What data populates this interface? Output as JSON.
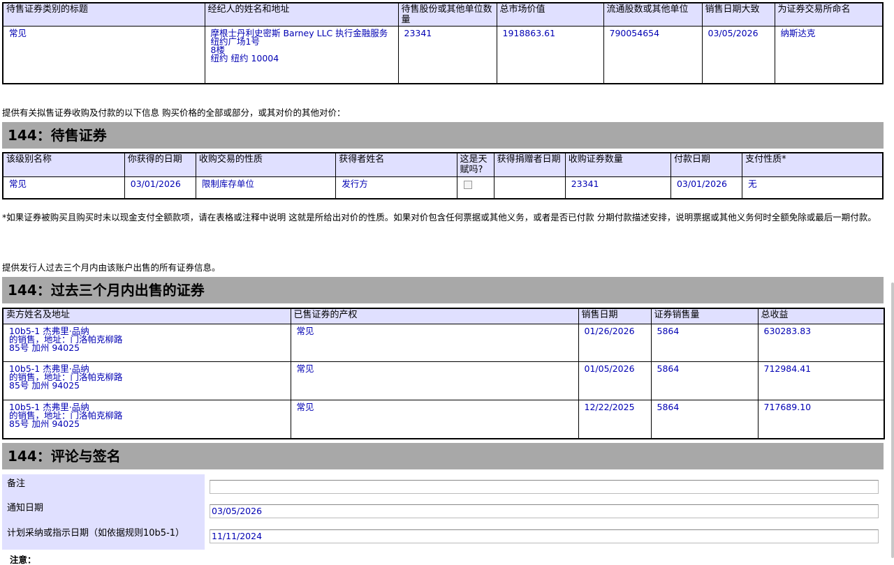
{
  "table1": {
    "headers": [
      "待售证券类别的标题",
      "经纪人的姓名和地址",
      "待售股份或其他单位数量",
      "总市场价值",
      "流通股数或其他单位",
      "销售日期大致",
      "为证券交易所命名"
    ],
    "row": {
      "title": "常见",
      "broker_lines": [
        "摩根士丹利史密斯 Barney LLC 执行金融服务",
        "纽约广场1号",
        "8楼",
        "纽约 纽约 10004"
      ],
      "units": "23341",
      "market_value": "1918863.61",
      "outstanding": "790054654",
      "sale_date": "03/05/2026",
      "exchange": "纳斯达克"
    }
  },
  "intro1": "提供有关拟售证券收购及付款的以下信息 购买价格的全部或部分，或其对价的其他对价：",
  "section1_title": "144：待售证券",
  "table2": {
    "headers": [
      "该级别名称",
      "你获得的日期",
      "收购交易的性质",
      "获得者姓名",
      "这是天赋吗?",
      "获得捐赠者日期",
      "收购证券数量",
      "付款日期",
      "支付性质*"
    ],
    "row": {
      "class": "常见",
      "acquired": "03/01/2026",
      "nature": "限制库存单位",
      "acquirer": "发行方",
      "gift": false,
      "donor_date": "",
      "amount": "23341",
      "pay_date": "03/01/2026",
      "pay_nature": "无"
    }
  },
  "footnote": "*如果证券被购买且购买时未以现金支付全额款项，请在表格或注释中说明 这就是所给出对价的性质。如果对价包含任何票据或其他义务，或者是否已付款 分期付款描述安排，说明票据或其他义务何时全额免除或最后一期付款。",
  "intro2": "提供发行人过去三个月内由该账户出售的所有证券信息。",
  "section2_title": "144：过去三个月内出售的证券",
  "table3": {
    "headers": [
      "卖方姓名及地址",
      "已售证券的产权",
      "销售日期",
      "证券销售量",
      "总收益"
    ],
    "rows": [
      {
        "seller": [
          "10b5-1 杰弗里·品纳",
          "的销售，地址：门洛帕克柳路",
          "85号 加州 94025"
        ],
        "title": "常见",
        "date": "01/26/2026",
        "qty": "5864",
        "proceeds": "630283.83"
      },
      {
        "seller": [
          "10b5-1 杰弗里·品纳",
          "的销售，地址：门洛帕克柳路",
          "85号 加州 94025"
        ],
        "title": "常见",
        "date": "01/05/2026",
        "qty": "5864",
        "proceeds": "712984.41"
      },
      {
        "seller": [
          "10b5-1 杰弗里·品纳",
          "的销售，地址：门洛帕克柳路",
          "85号 加州 94025"
        ],
        "title": "常见",
        "date": "12/22/2025",
        "qty": "5864",
        "proceeds": "717689.10"
      }
    ]
  },
  "section3_title": "144：评论与签名",
  "form": {
    "remarks_label": "备注",
    "remarks_value": "",
    "notice_label": "通知日期",
    "notice_value": "03/05/2026",
    "plan_label": "计划采纳或指示日期（如依据规则10b5-1）",
    "plan_value": "11/11/2024"
  },
  "attention_label": "注意："
}
